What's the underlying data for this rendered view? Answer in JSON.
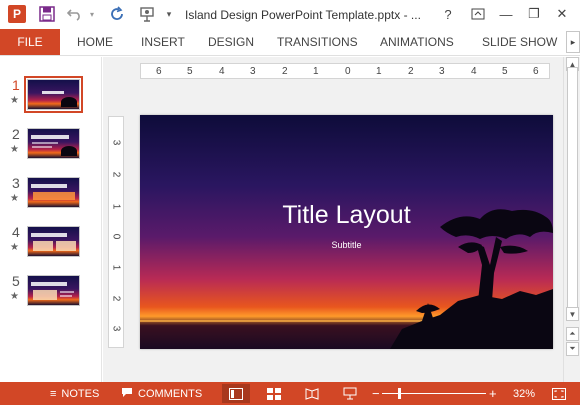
{
  "window": {
    "title": "Island Design PowerPoint Template.pptx - ...",
    "app_icon_letter": "P",
    "help_label": "?",
    "controls": {
      "ribbon_display": "⬆",
      "minimize": "—",
      "restore": "❐",
      "close": "✕"
    }
  },
  "quick_access": {
    "icons": [
      "save-icon",
      "undo-icon",
      "redo-icon",
      "presenter-icon",
      "customize-dropdown-icon"
    ]
  },
  "ribbon": {
    "tabs": [
      "FILE",
      "HOME",
      "INSERT",
      "DESIGN",
      "TRANSITIONS",
      "ANIMATIONS",
      "SLIDE SHOW"
    ],
    "scroll_label": "▸"
  },
  "thumbnails": [
    {
      "number": "1",
      "star": "★",
      "active": true
    },
    {
      "number": "2",
      "star": "★",
      "active": false
    },
    {
      "number": "3",
      "star": "★",
      "active": false
    },
    {
      "number": "4",
      "star": "★",
      "active": false
    },
    {
      "number": "5",
      "star": "★",
      "active": false
    }
  ],
  "rulers": {
    "horizontal": [
      "6",
      "5",
      "4",
      "3",
      "2",
      "1",
      "0",
      "1",
      "2",
      "3",
      "4",
      "5",
      "6"
    ],
    "vertical": [
      "3",
      "2",
      "1",
      "0",
      "1",
      "2",
      "3"
    ]
  },
  "slide": {
    "title": "Title Layout",
    "subtitle": "Subtitle"
  },
  "statusbar": {
    "notes_label": "NOTES",
    "comments_label": "COMMENTS",
    "zoom_minus": "−",
    "zoom_plus": "+",
    "zoom_level": "32%",
    "zoom_percent": 32
  },
  "colors": {
    "accent": "#d24726",
    "accent_dark": "#a8381d"
  }
}
